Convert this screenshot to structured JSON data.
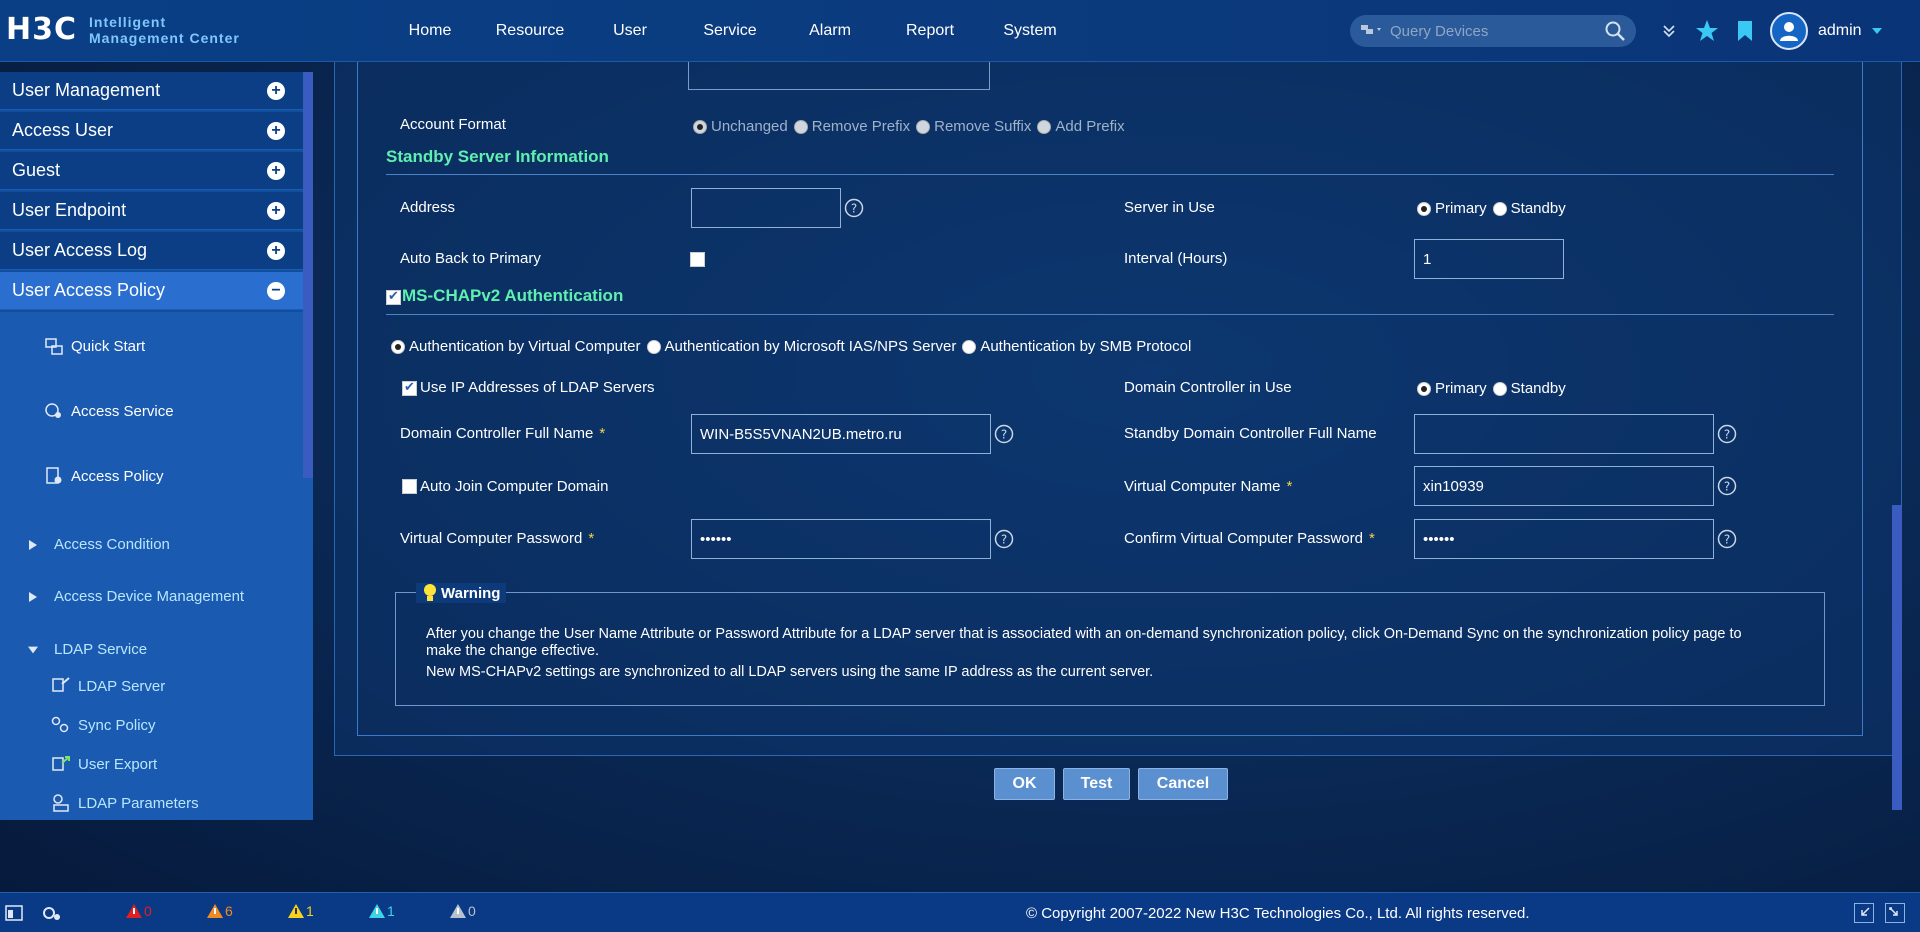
{
  "header": {
    "logo_mark": "H3C",
    "logo_line1": "Intelligent",
    "logo_line2": "Management Center",
    "nav": [
      "Home",
      "Resource",
      "User",
      "Service",
      "Alarm",
      "Report",
      "System"
    ],
    "search_placeholder": "Query Devices",
    "username": "admin"
  },
  "sidebar": {
    "groups": [
      "User Management",
      "Access User",
      "Guest",
      "User Endpoint",
      "User Access Log",
      "User Access Policy"
    ],
    "active_group": "User Access Policy",
    "links": [
      "Quick Start",
      "Access Service",
      "Access Policy"
    ],
    "categories": [
      "Access Condition",
      "Access Device Management",
      "LDAP Service"
    ],
    "ldap_items": [
      "LDAP Server",
      "Sync Policy",
      "User Export",
      "LDAP Parameters"
    ]
  },
  "form": {
    "account_format_label": "Account Format",
    "account_format_options": [
      "Unchanged",
      "Remove Prefix",
      "Remove Suffix",
      "Add Prefix"
    ],
    "standby_title": "Standby Server Information",
    "address_label": "Address",
    "address_value": "",
    "server_in_use_label": "Server in Use",
    "server_options": [
      "Primary",
      "Standby"
    ],
    "auto_back_label": "Auto Back to Primary",
    "interval_label": "Interval (Hours)",
    "interval_value": "1",
    "mschap_title": "MS-CHAPv2 Authentication",
    "auth_options": [
      "Authentication by Virtual Computer",
      "Authentication by Microsoft IAS/NPS Server",
      "Authentication by SMB Protocol"
    ],
    "use_ip_label": "Use IP Addresses of LDAP Servers",
    "dc_in_use_label": "Domain Controller in Use",
    "dc_options": [
      "Primary",
      "Standby"
    ],
    "dc_full_name_label": "Domain Controller Full Name",
    "dc_full_name_value": "WIN-B5S5VNAN2UB.metro.ru",
    "standby_dc_label": "Standby Domain Controller Full Name",
    "standby_dc_value": "",
    "auto_join_label": "Auto Join Computer Domain",
    "vc_name_label": "Virtual Computer Name",
    "vc_name_value": "xin10939",
    "vc_password_label": "Virtual Computer Password",
    "vc_password_value": "secret",
    "confirm_password_label": "Confirm Virtual Computer Password",
    "confirm_password_value": "secret",
    "required_mark": "*"
  },
  "warning": {
    "title": "Warning",
    "line1": "After you change the User Name Attribute or Password Attribute for a LDAP server that is associated with an on-demand synchronization policy, click On-Demand Sync on the synchronization policy page to",
    "line2": "make the change effective.",
    "line3": "New MS-CHAPv2 settings are synchronized to all LDAP servers using the same IP address as the current server."
  },
  "buttons": {
    "ok": "OK",
    "test": "Test",
    "cancel": "Cancel"
  },
  "footer": {
    "alarm_counts": [
      "0",
      "6",
      "1",
      "1",
      "0"
    ],
    "alarm_colors": [
      "#e02020",
      "#f08a24",
      "#f5d21f",
      "#3fd3e6",
      "#b8c2cc"
    ],
    "copyright": "© Copyright 2007-2022 New H3C Technologies Co., Ltd. All rights reserved."
  }
}
